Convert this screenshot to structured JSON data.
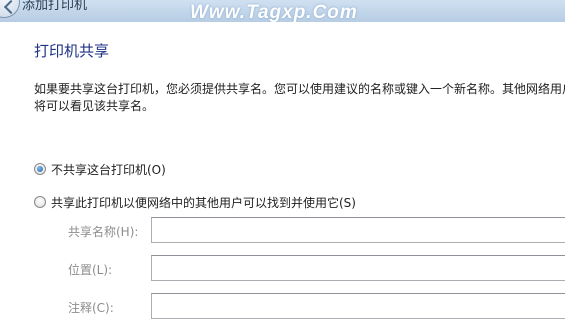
{
  "window": {
    "title": "添加打印机",
    "watermark": "Www.Tagxp.Com"
  },
  "page": {
    "heading": "打印机共享",
    "description": "如果要共享这台打印机，您必须提供共享名。您可以使用建议的名称或键入一个新名称。其他网络用户将可以看见该共享名。"
  },
  "sharing": {
    "options": [
      {
        "label": "不共享这台打印机(O)",
        "checked": true
      },
      {
        "label": "共享此打印机以便网络中的其他用户可以找到并使用它(S)",
        "checked": false
      }
    ],
    "fields": [
      {
        "label": "共享名称(H):",
        "value": ""
      },
      {
        "label": "位置(L):",
        "value": ""
      },
      {
        "label": "注释(C):",
        "value": ""
      }
    ]
  },
  "colors": {
    "heading": "#1e3287",
    "disabled_label": "#8d8d8d",
    "input_border": "#abadb3"
  }
}
